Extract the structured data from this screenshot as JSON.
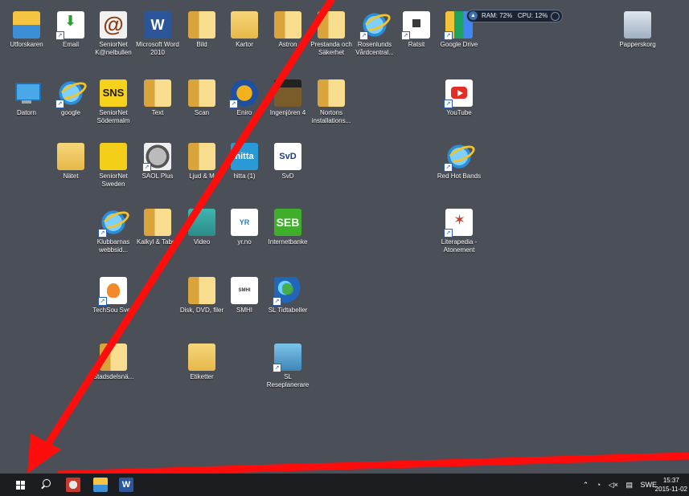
{
  "desktop": {
    "icons": [
      {
        "label": "Utforskaren",
        "icon": "file-explorer-icon"
      },
      {
        "label": "Email",
        "icon": "mail-download-icon"
      },
      {
        "label": "SeniorNet K@nelbullen",
        "icon": "at-sign-icon"
      },
      {
        "label": "Microsoft Word 2010",
        "icon": "word-icon"
      },
      {
        "label": "Bild",
        "icon": "folder-icon"
      },
      {
        "label": "Kartor",
        "icon": "folder-icon"
      },
      {
        "label": "Astron",
        "icon": "folder-icon"
      },
      {
        "label": "Prestanda och Säkerhet",
        "icon": "folder-icon"
      },
      {
        "label": "Rosenlunds Vårdcentral...",
        "icon": "internet-explorer-icon"
      },
      {
        "label": "Ratsit",
        "icon": "ratsit-icon"
      },
      {
        "label": "Google Drive",
        "icon": "google-drive-icon"
      },
      {
        "label": "Papperskorg",
        "icon": "recycle-bin-icon"
      },
      {
        "label": "Datorn",
        "icon": "computer-icon"
      },
      {
        "label": "google",
        "icon": "internet-explorer-icon"
      },
      {
        "label": "SeniorNet Södermalm",
        "icon": "sns-icon"
      },
      {
        "label": "Text",
        "icon": "folder-icon"
      },
      {
        "label": "Scan",
        "icon": "folder-icon"
      },
      {
        "label": "Eniro",
        "icon": "eniro-icon"
      },
      {
        "label": "Ingenjören 4",
        "icon": "building-icon"
      },
      {
        "label": "Nortons installations...",
        "icon": "folder-icon"
      },
      {
        "label": "YouTube",
        "icon": "youtube-icon"
      },
      {
        "label": "Nätet",
        "icon": "folder-icon"
      },
      {
        "label": "SeniorNet Sweden",
        "icon": "seniornet-sweden-icon"
      },
      {
        "label": "SAOL Plus",
        "icon": "saol-icon"
      },
      {
        "label": "Ljud & M",
        "icon": "folder-icon"
      },
      {
        "label": "hitta (1)",
        "icon": "hitta-icon"
      },
      {
        "label": "SvD",
        "icon": "svd-icon"
      },
      {
        "label": "Red Hot Bands",
        "icon": "internet-explorer-icon"
      },
      {
        "label": "Klubbarnas webbsid...",
        "icon": "internet-explorer-icon"
      },
      {
        "label": "Kalkyl & Tabell",
        "icon": "folder-icon"
      },
      {
        "label": "Video",
        "icon": "video-icon"
      },
      {
        "label": "yr.no",
        "icon": "yr-icon"
      },
      {
        "label": "Internetbanke",
        "icon": "seb-icon"
      },
      {
        "label": "Literapedia - Atonement",
        "icon": "literapedia-icon"
      },
      {
        "label": "TechSou Sveri",
        "icon": "techsoup-icon"
      },
      {
        "label": "Disk, DVD, filer",
        "icon": "folder-icon"
      },
      {
        "label": "SMHI",
        "icon": "smhi-icon"
      },
      {
        "label": "SL Tidtabeller",
        "icon": "globe-icon"
      },
      {
        "label": "Stadsdelsnä...",
        "icon": "folder-icon"
      },
      {
        "label": "Etiketter",
        "icon": "folder-icon"
      },
      {
        "label": "SL Reseplanerare",
        "icon": "network-icon"
      }
    ]
  },
  "glyphs": {
    "word": "W",
    "at": "@",
    "sns": "SNS",
    "seb": "SEB",
    "hitta": "hitta",
    "svd": "SvD",
    "smhi": "SMHI",
    "yr": "YR",
    "shortcut": "↗"
  },
  "monitor": {
    "ram": "RAM: 72%",
    "cpu": "CPU: 12%"
  },
  "taskbar": {
    "tray_lang": "SWE",
    "clock_time": "15:37",
    "clock_date": "2015-11-02",
    "tray_icons": [
      "chevron-up-icon",
      "network-icon",
      "speaker-muted-icon",
      "notification-icon"
    ]
  },
  "colors": {
    "desktop_bg": "#4b4f58",
    "taskbar_bg": "#1c1d20",
    "annotation_red": "#ff0d0d"
  }
}
